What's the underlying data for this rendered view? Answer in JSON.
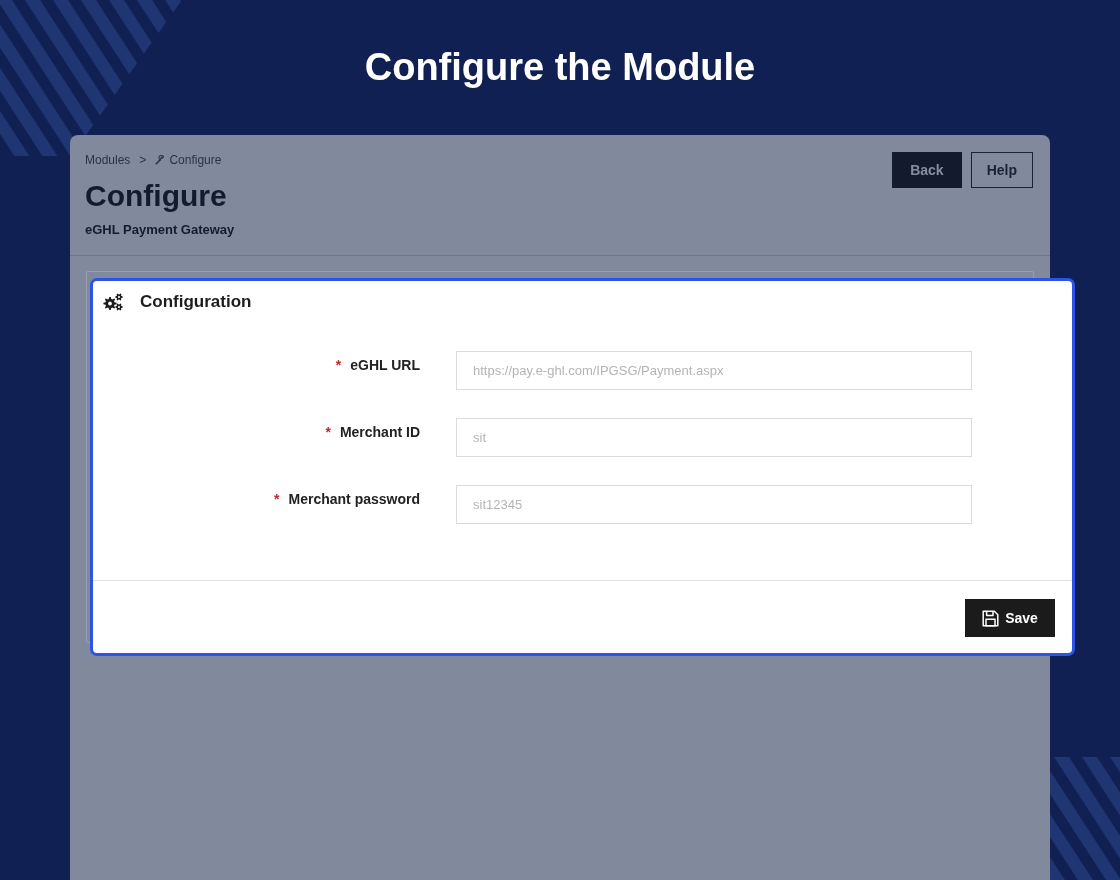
{
  "page_title": "Configure the Module",
  "panel": {
    "breadcrumb": {
      "items": [
        "Modules",
        "Configure"
      ],
      "separator": ">"
    },
    "title": "Configure",
    "subtitle": "eGHL Payment Gateway",
    "buttons": [
      {
        "label": "Back",
        "kind": "primary"
      },
      {
        "label": "Help",
        "kind": "outline"
      }
    ]
  },
  "configuration": {
    "title": "Configuration",
    "fields": [
      {
        "label": "eGHL URL",
        "required_mark": "*",
        "value": "https://pay.e-ghl.com/IPGSG/Payment.aspx"
      },
      {
        "label": "Merchant ID",
        "required_mark": "*",
        "value": "sit"
      },
      {
        "label": "Merchant password",
        "required_mark": "*",
        "value": "sit12345"
      }
    ],
    "save_button": "Save"
  }
}
